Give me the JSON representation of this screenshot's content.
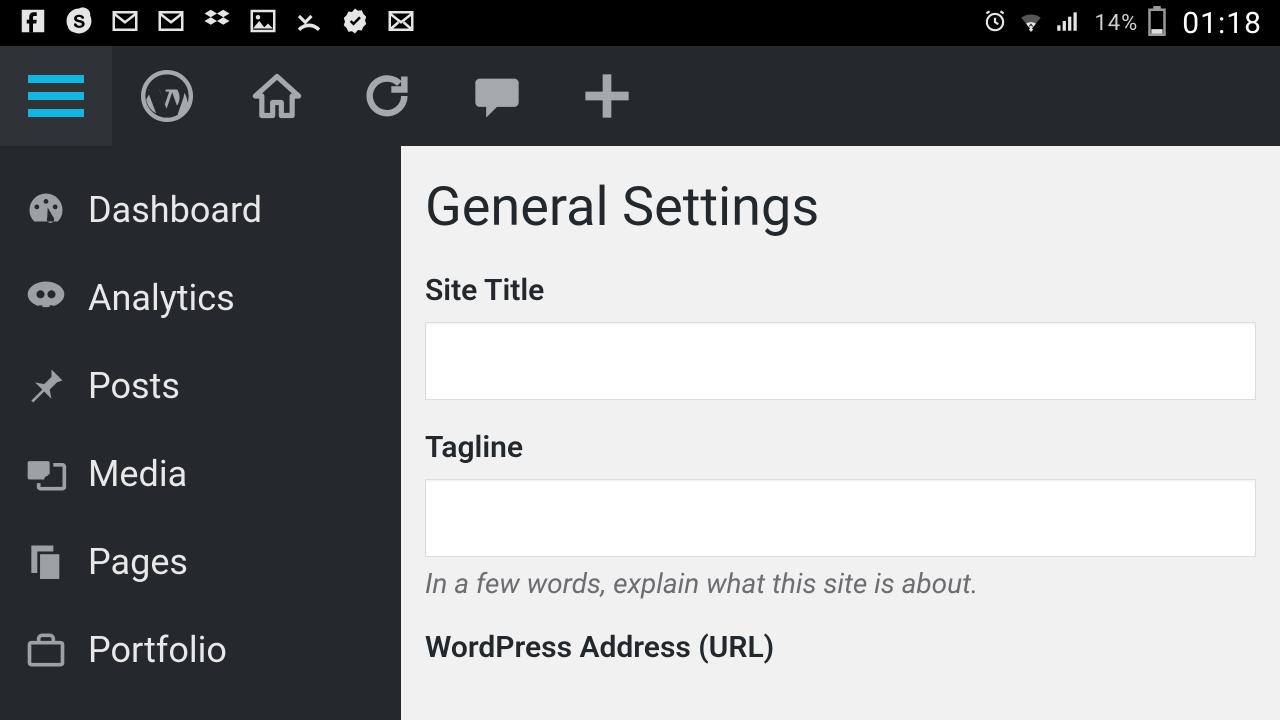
{
  "statusbar": {
    "battery_pct": "14%",
    "clock": "01:18"
  },
  "adminbar": {
    "icons": [
      "hamburger",
      "wordpress",
      "home",
      "refresh",
      "comment",
      "plus"
    ]
  },
  "sidebar": {
    "items": [
      {
        "label": "Dashboard",
        "icon": "dashboard"
      },
      {
        "label": "Analytics",
        "icon": "analytics"
      },
      {
        "label": "Posts",
        "icon": "pin"
      },
      {
        "label": "Media",
        "icon": "media"
      },
      {
        "label": "Pages",
        "icon": "pages"
      },
      {
        "label": "Portfolio",
        "icon": "portfolio"
      }
    ]
  },
  "main": {
    "title": "General Settings",
    "fields": {
      "site_title": {
        "label": "Site Title",
        "value": ""
      },
      "tagline": {
        "label": "Tagline",
        "value": "",
        "description": "In a few words, explain what this site is about."
      },
      "wp_address": {
        "label": "WordPress Address (URL)"
      }
    }
  }
}
